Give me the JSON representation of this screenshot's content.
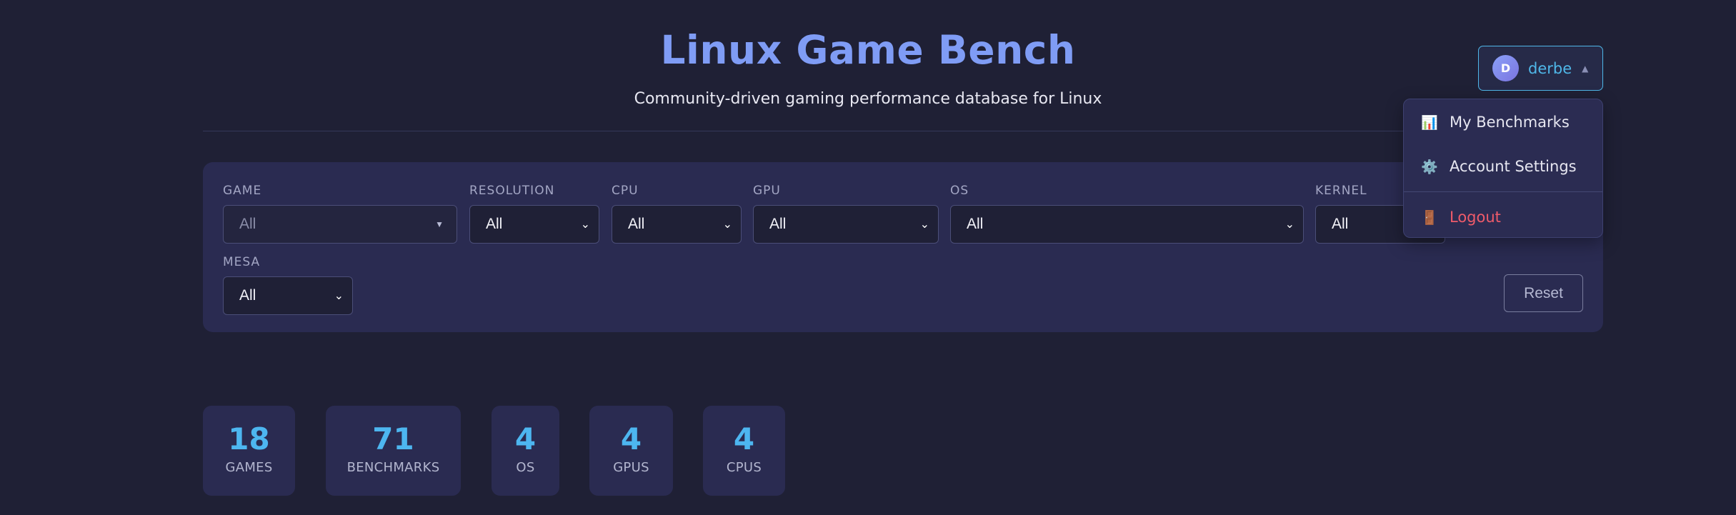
{
  "header": {
    "title": "Linux Game Bench",
    "subtitle": "Community-driven gaming performance database for Linux"
  },
  "user": {
    "initial": "D",
    "name": "derbe",
    "caret": "▲",
    "menu": [
      {
        "icon": "📊",
        "label": "My Benchmarks"
      },
      {
        "icon": "⚙️",
        "label": "Account Settings"
      },
      {
        "icon": "🚪",
        "label": "Logout"
      }
    ]
  },
  "filters": {
    "game": {
      "label": "GAME",
      "value": "All"
    },
    "resolution": {
      "label": "RESOLUTION",
      "value": "All"
    },
    "cpu": {
      "label": "CPU",
      "value": "All"
    },
    "gpu": {
      "label": "GPU",
      "value": "All"
    },
    "os": {
      "label": "OS",
      "value": "All"
    },
    "kernel": {
      "label": "KERNEL",
      "value": "All"
    },
    "mesa": {
      "label": "MESA",
      "value": "All"
    },
    "reset_label": "Reset"
  },
  "stats": [
    {
      "value": "18",
      "label": "GAMES"
    },
    {
      "value": "71",
      "label": "BENCHMARKS"
    },
    {
      "value": "4",
      "label": "OS"
    },
    {
      "value": "4",
      "label": "GPUS"
    },
    {
      "value": "4",
      "label": "CPUS"
    }
  ],
  "colors": {
    "accent": "#7f9cf5",
    "stat_number": "#4db6f0",
    "logout": "#ef5b6a",
    "panel": "#2a2b51",
    "background": "#1f2035"
  }
}
